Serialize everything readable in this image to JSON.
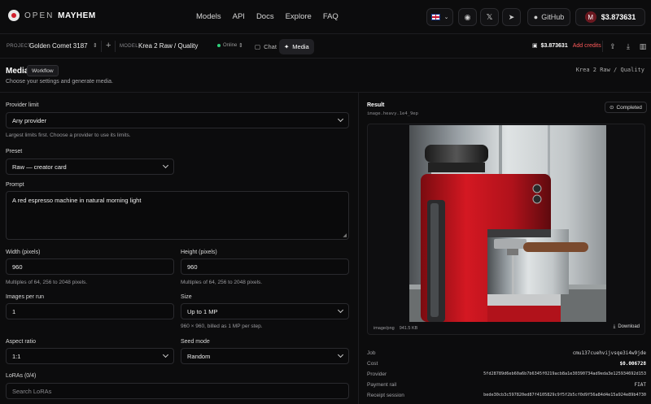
{
  "brand": {
    "open": "OPEN",
    "name": "MAYHEM"
  },
  "nav": {
    "links": [
      "Models",
      "API",
      "Docs",
      "Explore",
      "FAQ"
    ],
    "github": "GitHub",
    "balance": "$3.873631",
    "avatar_initial": "M"
  },
  "subbar": {
    "project_label": "PROJECT",
    "project_value": "Golden Comet 3187",
    "model_label": "MODEL",
    "model_value": "Krea 2 Raw / Quality",
    "status": "Online",
    "tab_chat": "Chat",
    "tab_media": "Media",
    "credits_balance": "$3.873631",
    "add_credits": "Add credits"
  },
  "header": {
    "title": "Media",
    "workflow": "Workflow",
    "subtitle": "Choose your settings and generate media.",
    "model_right": "Krea 2 Raw / Quality"
  },
  "form": {
    "provider_label": "Provider limit",
    "provider_value": "Any provider",
    "provider_hint": "Largest limits first. Choose a provider to use its limits.",
    "preset_label": "Preset",
    "preset_value": "Raw — creator card",
    "prompt_label": "Prompt",
    "prompt_value": "A red espresso machine in natural morning light",
    "width_label": "Width (pixels)",
    "width_value": "960",
    "width_hint": "Multiples of 64, 256 to 2048 pixels.",
    "height_label": "Height (pixels)",
    "height_value": "960",
    "height_hint": "Multiples of 64, 256 to 2048 pixels.",
    "images_label": "Images per run",
    "images_value": "1",
    "size_label": "Size",
    "size_value": "Up to 1 MP",
    "size_hint": "960 × 960, billed as 1 MP per step.",
    "aspect_label": "Aspect ratio",
    "aspect_value": "1:1",
    "seed_label": "Seed mode",
    "seed_value": "Random",
    "loras_label": "LoRAs (0/4)",
    "loras_placeholder": "Search LoRAs"
  },
  "result": {
    "title": "Result",
    "subtitle": "image.heavy.1e4_9ep",
    "status": "Completed",
    "mime": "image/png",
    "size": "941.5 KB",
    "download": "Download",
    "meta": [
      {
        "label": "Job",
        "value": "cmu137cuehvijvsqe3i4w9jde"
      },
      {
        "label": "Cost",
        "value": "$0.006728"
      },
      {
        "label": "Provider",
        "value": "5fd28789d6eb60a6b7b6345f0219acb8a1e30390734ad9eda3e125934692d153"
      },
      {
        "label": "Payment rail",
        "value": "FIAT"
      },
      {
        "label": "Receipt session",
        "value": "bede30cb3c597820ed87f4105829c9f5f2b5cf0d9f56a84d4e15a924e89b4730"
      }
    ]
  },
  "colors": {
    "accent_red": "#d01e2a",
    "online": "#2fd07a",
    "add_credits": "#ff5a5a"
  }
}
